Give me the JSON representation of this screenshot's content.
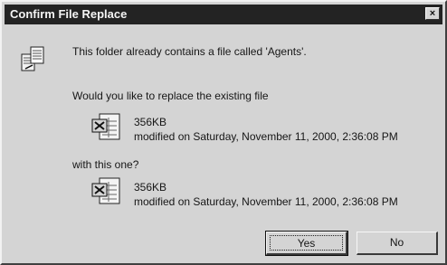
{
  "window": {
    "title": "Confirm File Replace",
    "close_glyph": "×"
  },
  "message": {
    "intro": "This folder already contains a file called 'Agents'.",
    "question": "Would you like to replace the existing file",
    "with_this": "with this one?"
  },
  "existing_file": {
    "size": "356KB",
    "modified": "modified on Saturday, November 11, 2000, 2:36:08 PM",
    "icon": "excel-file-icon"
  },
  "new_file": {
    "size": "356KB",
    "modified": "modified on Saturday, November 11, 2000, 2:36:08 PM",
    "icon": "excel-file-icon"
  },
  "buttons": {
    "yes_label": "Yes",
    "no_label": "No"
  },
  "icons": {
    "header": "file-replace-icon"
  }
}
